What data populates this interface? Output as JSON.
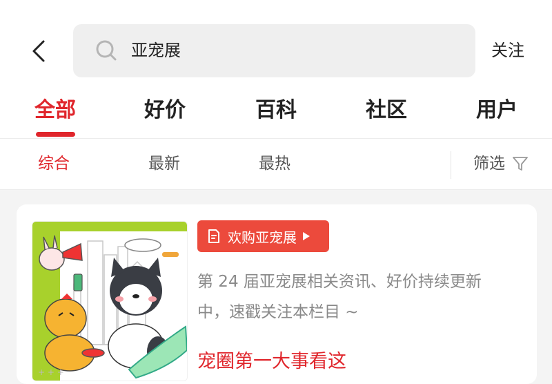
{
  "header": {
    "search_query": "亚宠展",
    "follow_label": "关注"
  },
  "tabs": [
    {
      "label": "全部",
      "active": true
    },
    {
      "label": "好价",
      "active": false
    },
    {
      "label": "百科",
      "active": false
    },
    {
      "label": "社区",
      "active": false
    },
    {
      "label": "用户",
      "active": false
    }
  ],
  "filters": {
    "items": [
      {
        "label": "综合",
        "active": true
      },
      {
        "label": "最新",
        "active": false
      },
      {
        "label": "最热",
        "active": false
      }
    ],
    "screen_label": "筛选"
  },
  "card": {
    "tag_label": "欢购亚宠展",
    "description": "第 24 届亚宠展相关资讯、好价持续更新中，速戳关注本栏目 ~",
    "title": "宠圈第一大事看这"
  },
  "icons": {
    "back": "chevron-left-icon",
    "search": "search-icon",
    "filter": "filter-icon",
    "tag": "document-icon",
    "play": "play-icon"
  },
  "colors": {
    "accent": "#e0262c",
    "tag_bg": "#ec4a3c",
    "text": "#222222",
    "muted": "#8a8a8a"
  }
}
